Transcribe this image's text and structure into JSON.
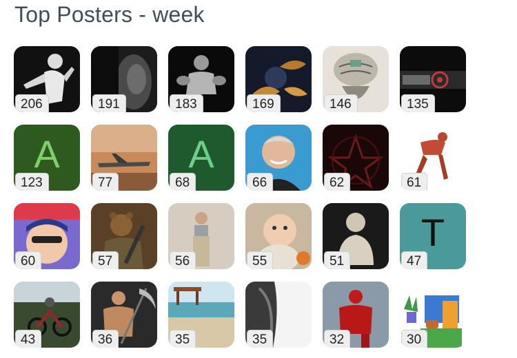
{
  "header": {
    "title": "Top Posters - week"
  },
  "posters": [
    {
      "count": "206",
      "avatar": "silhouette-basketball-player-image",
      "letter": ""
    },
    {
      "count": "191",
      "avatar": "dark-face-shadow-image",
      "letter": ""
    },
    {
      "count": "183",
      "avatar": "bodybuilder-dark-image",
      "letter": ""
    },
    {
      "count": "169",
      "avatar": "gold-floral-dark-image",
      "letter": ""
    },
    {
      "count": "146",
      "avatar": "brain-sketch-image",
      "letter": ""
    },
    {
      "count": "135",
      "avatar": "stocks-logo-image",
      "letter": ""
    },
    {
      "count": "123",
      "avatar": "letter-avatar",
      "letter": "A",
      "bg": "#2e5a1f",
      "fg": "#7fd06a"
    },
    {
      "count": "77",
      "avatar": "cargo-plane-desert-image",
      "letter": ""
    },
    {
      "count": "68",
      "avatar": "letter-avatar",
      "letter": "A",
      "bg": "#1f5a2f",
      "fg": "#6cd08a"
    },
    {
      "count": "66",
      "avatar": "smiling-man-portrait-image",
      "letter": ""
    },
    {
      "count": "62",
      "avatar": "pentagram-dark-image",
      "letter": ""
    },
    {
      "count": "61",
      "avatar": "anatomy-figure-kneeling-image",
      "letter": ""
    },
    {
      "count": "60",
      "avatar": "cartoon-character-meme-image",
      "letter": ""
    },
    {
      "count": "57",
      "avatar": "armored-bear-image",
      "letter": ""
    },
    {
      "count": "56",
      "avatar": "mirror-selfie-image",
      "letter": ""
    },
    {
      "count": "55",
      "avatar": "baby-photo-image",
      "letter": ""
    },
    {
      "count": "51",
      "avatar": "buddha-statue-image",
      "letter": ""
    },
    {
      "count": "47",
      "avatar": "letter-avatar",
      "letter": "T",
      "bg": "#4b9a9a",
      "fg": "#111111"
    },
    {
      "count": "43",
      "avatar": "motocross-rider-image",
      "letter": ""
    },
    {
      "count": "36",
      "avatar": "warrior-with-scythe-image",
      "letter": ""
    },
    {
      "count": "35",
      "avatar": "beach-scene-image",
      "letter": ""
    },
    {
      "count": "35",
      "avatar": "muscle-arm-grayscale-image",
      "letter": ""
    },
    {
      "count": "32",
      "avatar": "spider-hero-image",
      "letter": ""
    },
    {
      "count": "30",
      "avatar": "coffee-plant-illustration-image",
      "letter": ""
    }
  ]
}
